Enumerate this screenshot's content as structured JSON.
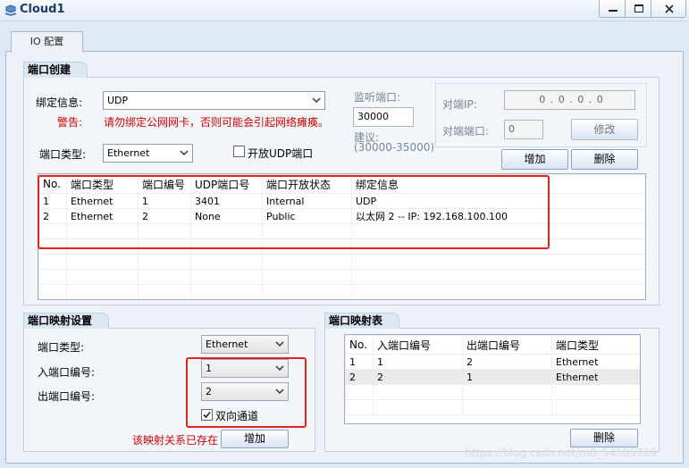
{
  "window": {
    "title": "Cloud1"
  },
  "tabs": [
    {
      "label": "IO 配置"
    }
  ],
  "port_create": {
    "legend": "端口创建",
    "bind_label": "绑定信息:",
    "bind_value": "UDP",
    "warning_label": "警告:",
    "warning_text": "请勿绑定公网网卡，否则可能会引起网络瘫痪。",
    "port_type_label": "端口类型:",
    "port_type_value": "Ethernet",
    "open_udp_label": "开放UDP端口",
    "listen_port_label": "监听端口:",
    "listen_port_value": "30000",
    "suggest_label": "建议:",
    "suggest_range": "(30000-35000)",
    "peer_ip_label": "对端IP:",
    "peer_ip_value": "0 . 0 . 0 . 0",
    "peer_port_label": "对端端口:",
    "peer_port_value": "0",
    "modify_button": "修改",
    "add_button": "增加",
    "delete_button": "删除",
    "table": {
      "headers": [
        "No.",
        "端口类型",
        "端口编号",
        "UDP端口号",
        "端口开放状态",
        "绑定信息"
      ],
      "rows": [
        [
          "1",
          "Ethernet",
          "1",
          "3401",
          "Internal",
          "UDP"
        ],
        [
          "2",
          "Ethernet",
          "2",
          "None",
          "Public",
          "以太网 2 -- IP: 192.168.100.100"
        ]
      ]
    }
  },
  "mapping_settings": {
    "legend": "端口映射设置",
    "port_type_label": "端口类型:",
    "port_type_value": "Ethernet",
    "in_port_label": "入端口编号:",
    "in_port_value": "1",
    "out_port_label": "出端口编号:",
    "out_port_value": "2",
    "bidirectional_label": "双向通道",
    "bidirectional_checked": true,
    "status_text": "该映射关系已存在",
    "add_button": "增加"
  },
  "mapping_table": {
    "legend": "端口映射表",
    "headers": [
      "No.",
      "入端口编号",
      "出端口编号",
      "端口类型"
    ],
    "rows": [
      [
        "1",
        "1",
        "2",
        "Ethernet"
      ],
      [
        "2",
        "2",
        "1",
        "Ethernet"
      ]
    ],
    "delete_button": "删除"
  },
  "watermark": "https://blog.csdn.net/m0_54585789",
  "colors": {
    "warning": "#cc0000",
    "highlight_box": "#e0241b",
    "title": "#1a3a6b"
  }
}
